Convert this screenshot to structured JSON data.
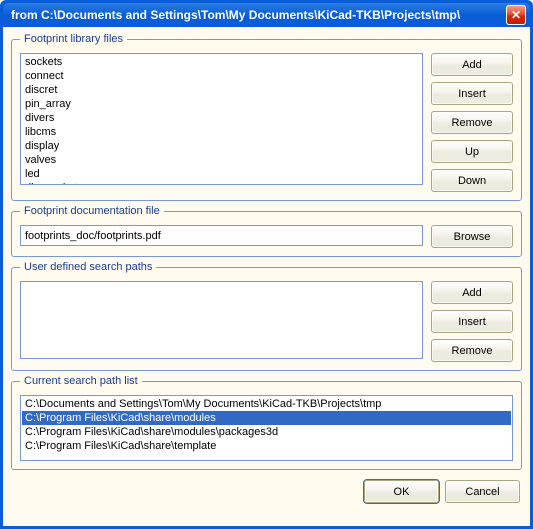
{
  "title": "from C:\\Documents and Settings\\Tom\\My Documents\\KiCad-TKB\\Projects\\tmp\\",
  "groups": {
    "libs": {
      "legend": "Footprint library files",
      "items": [
        "sockets",
        "connect",
        "discret",
        "pin_array",
        "divers",
        "libcms",
        "display",
        "valves",
        "led",
        "dip_sockets"
      ],
      "selected_index": -1,
      "buttons": {
        "add": "Add",
        "insert": "Insert",
        "remove": "Remove",
        "up": "Up",
        "down": "Down"
      }
    },
    "doc": {
      "legend": "Footprint documentation file",
      "value": "footprints_doc/footprints.pdf",
      "browse": "Browse"
    },
    "user": {
      "legend": "User defined search paths",
      "items": [],
      "selected_index": -1,
      "buttons": {
        "add": "Add",
        "insert": "Insert",
        "remove": "Remove"
      }
    },
    "current": {
      "legend": "Current search path list",
      "items": [
        "C:\\Documents and Settings\\Tom\\My Documents\\KiCad-TKB\\Projects\\tmp",
        "C:\\Program Files\\KiCad\\share\\modules",
        "C:\\Program Files\\KiCad\\share\\modules\\packages3d",
        "C:\\Program Files\\KiCad\\share\\template"
      ],
      "selected_index": 1
    }
  },
  "footer": {
    "ok": "OK",
    "cancel": "Cancel"
  }
}
